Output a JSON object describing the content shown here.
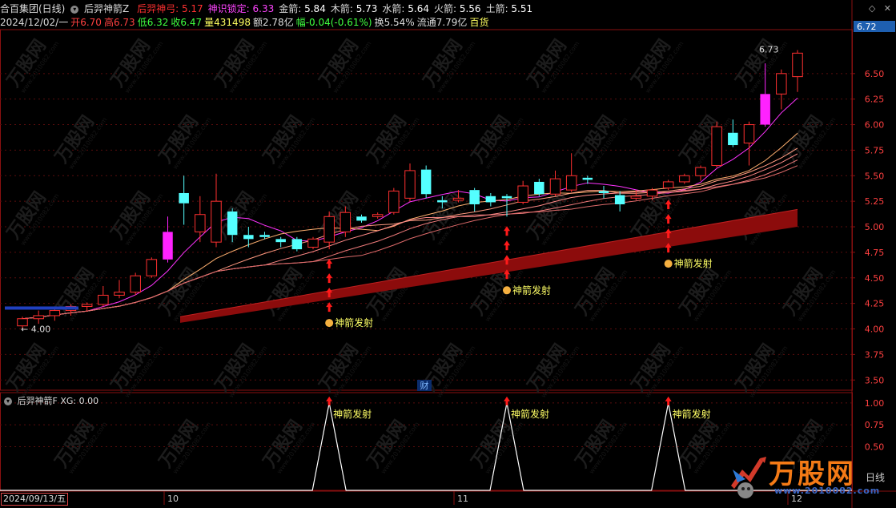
{
  "header": {
    "stock": "合百集团(日线)",
    "indicator": "后羿神箭Z",
    "vals": [
      {
        "label": "后羿神弓:",
        "value": "5.17",
        "color": "#ff3030"
      },
      {
        "label": "神识锁定:",
        "value": "6.33",
        "color": "#ff44ff"
      },
      {
        "label": "金箭:",
        "value": "5.84",
        "color": "#ffffff"
      },
      {
        "label": "木箭:",
        "value": "5.73",
        "color": "#ffffff"
      },
      {
        "label": "水箭:",
        "value": "5.64",
        "color": "#ffffff"
      },
      {
        "label": "火箭:",
        "value": "5.56",
        "color": "#ffffff"
      },
      {
        "label": "土箭:",
        "value": "5.51",
        "color": "#ffffff"
      }
    ],
    "row2": [
      {
        "text": "2024/12/02/一",
        "color": "#dddddd"
      },
      {
        "text": "开6.70",
        "color": "#ff4040"
      },
      {
        "text": "高6.73",
        "color": "#ff4040"
      },
      {
        "text": "低6.32",
        "color": "#40ff40"
      },
      {
        "text": "收6.47",
        "color": "#40ff40"
      },
      {
        "text": "量431498",
        "color": "#ffff60"
      },
      {
        "text": "额2.78亿",
        "color": "#dddddd"
      },
      {
        "text": "幅-0.04(-0.61%)",
        "color": "#40ff40"
      },
      {
        "text": "换5.54%",
        "color": "#dddddd"
      },
      {
        "text": "流通7.79亿",
        "color": "#dddddd"
      },
      {
        "text": "百货",
        "color": "#ffff60"
      }
    ]
  },
  "lower_title": "后羿神箭F  XG: 0.00",
  "date_box": "2024/09/13/五",
  "month_labels": [
    "10",
    "11",
    "12"
  ],
  "fin_marker": "财",
  "signal_label": "神箭发射",
  "max_label": "6.73",
  "min_label": "4.00",
  "price_tag": "6.72",
  "daily_label": "日线",
  "watermark_text": "万股网",
  "watermark_url": "www.2010082.com",
  "logo": {
    "main": "万股网",
    "sub": "www.2010082.com"
  },
  "chart_data": {
    "type": "candlestick",
    "ylim": [
      3.4,
      6.93
    ],
    "yticks": [
      3.5,
      3.75,
      4.0,
      4.25,
      4.5,
      4.75,
      5.0,
      5.25,
      5.5,
      5.75,
      6.0,
      6.25,
      6.5
    ],
    "lower_ylim": [
      0,
      1.1
    ],
    "lower_yticks": [
      0.5,
      0.75,
      1.0
    ],
    "candles": [
      {
        "o": 4.03,
        "h": 4.12,
        "l": 4.0,
        "c": 4.1
      },
      {
        "o": 4.1,
        "h": 4.18,
        "l": 4.05,
        "c": 4.13
      },
      {
        "o": 4.13,
        "h": 4.2,
        "l": 4.08,
        "c": 4.18
      },
      {
        "o": 4.18,
        "h": 4.24,
        "l": 4.13,
        "c": 4.22
      },
      {
        "o": 4.22,
        "h": 4.26,
        "l": 4.17,
        "c": 4.24
      },
      {
        "o": 4.24,
        "h": 4.42,
        "l": 4.22,
        "c": 4.33
      },
      {
        "o": 4.33,
        "h": 4.48,
        "l": 4.3,
        "c": 4.36
      },
      {
        "o": 4.36,
        "h": 4.55,
        "l": 4.33,
        "c": 4.52
      },
      {
        "o": 4.52,
        "h": 4.7,
        "l": 4.5,
        "c": 4.68
      },
      {
        "o": 4.68,
        "h": 5.1,
        "l": 4.65,
        "c": 4.95
      },
      {
        "o": 5.33,
        "h": 5.5,
        "l": 5.02,
        "c": 5.23
      },
      {
        "o": 4.95,
        "h": 5.3,
        "l": 4.85,
        "c": 5.12
      },
      {
        "o": 4.85,
        "h": 5.52,
        "l": 4.8,
        "c": 5.25
      },
      {
        "o": 5.15,
        "h": 5.18,
        "l": 4.85,
        "c": 4.92
      },
      {
        "o": 4.92,
        "h": 5.0,
        "l": 4.8,
        "c": 4.88
      },
      {
        "o": 4.92,
        "h": 4.95,
        "l": 4.88,
        "c": 4.9
      },
      {
        "o": 4.88,
        "h": 4.9,
        "l": 4.8,
        "c": 4.85
      },
      {
        "o": 4.88,
        "h": 4.9,
        "l": 4.76,
        "c": 4.78
      },
      {
        "o": 4.8,
        "h": 4.9,
        "l": 4.78,
        "c": 4.88
      },
      {
        "o": 4.85,
        "h": 5.15,
        "l": 4.78,
        "c": 5.1
      },
      {
        "o": 4.95,
        "h": 5.2,
        "l": 4.9,
        "c": 5.14
      },
      {
        "o": 5.1,
        "h": 5.12,
        "l": 5.04,
        "c": 5.06
      },
      {
        "o": 5.1,
        "h": 5.14,
        "l": 5.08,
        "c": 5.12
      },
      {
        "o": 5.14,
        "h": 5.38,
        "l": 5.12,
        "c": 5.35
      },
      {
        "o": 5.28,
        "h": 5.62,
        "l": 5.25,
        "c": 5.55
      },
      {
        "o": 5.56,
        "h": 5.6,
        "l": 5.28,
        "c": 5.32
      },
      {
        "o": 5.26,
        "h": 5.3,
        "l": 5.18,
        "c": 5.24
      },
      {
        "o": 5.26,
        "h": 5.36,
        "l": 5.24,
        "c": 5.28
      },
      {
        "o": 5.36,
        "h": 5.38,
        "l": 5.15,
        "c": 5.22
      },
      {
        "o": 5.3,
        "h": 5.33,
        "l": 5.2,
        "c": 5.24
      },
      {
        "o": 5.3,
        "h": 5.32,
        "l": 5.1,
        "c": 5.28
      },
      {
        "o": 5.24,
        "h": 5.45,
        "l": 5.22,
        "c": 5.4
      },
      {
        "o": 5.44,
        "h": 5.47,
        "l": 5.3,
        "c": 5.32
      },
      {
        "o": 5.32,
        "h": 5.55,
        "l": 5.3,
        "c": 5.47
      },
      {
        "o": 5.36,
        "h": 5.72,
        "l": 5.34,
        "c": 5.5
      },
      {
        "o": 5.48,
        "h": 5.5,
        "l": 5.42,
        "c": 5.46
      },
      {
        "o": 5.35,
        "h": 5.4,
        "l": 5.28,
        "c": 5.33
      },
      {
        "o": 5.31,
        "h": 5.35,
        "l": 5.15,
        "c": 5.22
      },
      {
        "o": 5.28,
        "h": 5.36,
        "l": 5.26,
        "c": 5.3
      },
      {
        "o": 5.3,
        "h": 5.38,
        "l": 5.26,
        "c": 5.36
      },
      {
        "o": 5.38,
        "h": 5.46,
        "l": 5.36,
        "c": 5.44
      },
      {
        "o": 5.44,
        "h": 5.52,
        "l": 5.42,
        "c": 5.5
      },
      {
        "o": 5.5,
        "h": 5.6,
        "l": 5.45,
        "c": 5.58
      },
      {
        "o": 5.6,
        "h": 6.03,
        "l": 5.58,
        "c": 5.98
      },
      {
        "o": 5.92,
        "h": 6.05,
        "l": 5.78,
        "c": 5.8
      },
      {
        "o": 5.82,
        "h": 6.03,
        "l": 5.6,
        "c": 6.0
      },
      {
        "o": 6.0,
        "h": 6.6,
        "l": 5.98,
        "c": 6.3
      },
      {
        "o": 6.3,
        "h": 6.54,
        "l": 6.15,
        "c": 6.5
      },
      {
        "o": 6.47,
        "h": 6.73,
        "l": 6.32,
        "c": 6.7
      }
    ],
    "limit_up_bars": [
      9,
      46
    ],
    "signal_bars": [
      19,
      30,
      40
    ],
    "band": {
      "start": [
        4.12,
        4.06
      ],
      "end": [
        5.17,
        5.0
      ]
    }
  }
}
